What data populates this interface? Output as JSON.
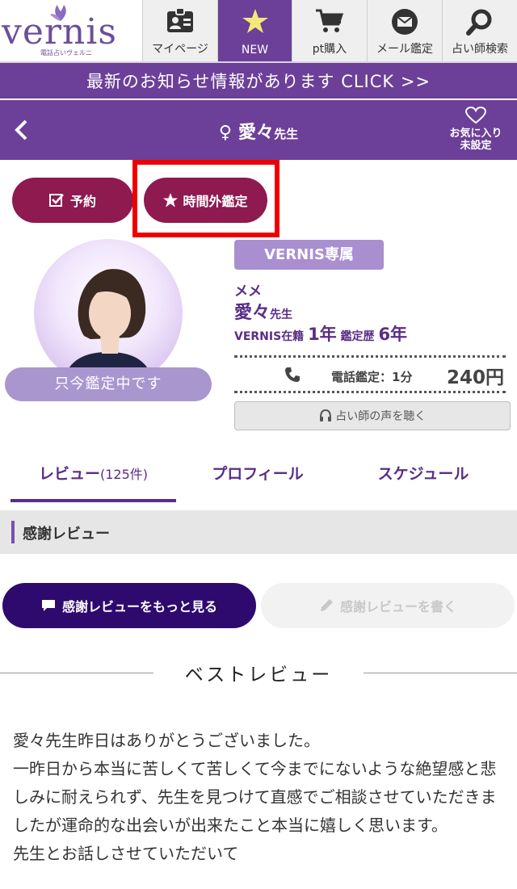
{
  "brand": {
    "logo_text": "vernis",
    "logo_sub": "電話占いヴェルニ"
  },
  "nav": [
    {
      "label": "マイページ",
      "icon": "id-card-icon"
    },
    {
      "label": "NEW",
      "icon": "star-icon"
    },
    {
      "label": "pt購入",
      "icon": "cart-icon"
    },
    {
      "label": "メール鑑定",
      "icon": "mail-icon"
    },
    {
      "label": "占い師検索",
      "icon": "search-icon"
    }
  ],
  "banner": "最新のお知らせ情報があります CLICK >>",
  "header": {
    "venus": "♀",
    "name": "愛々",
    "suffix": "先生",
    "fav_line1": "お気に入り",
    "fav_line2": "未設定"
  },
  "actions": {
    "reserve": "予約",
    "off_hours": "時間外鑑定"
  },
  "profile": {
    "status": "只今鑑定中です",
    "badge": "VERNIS専属",
    "nickname": "メメ",
    "name": "愛々",
    "suffix": "先生",
    "enrolled_label": "VERNIS在籍",
    "enrolled_value": "1年",
    "experience_label": "鑑定歴",
    "experience_value": "6年",
    "price_label": "電話鑑定：1分",
    "price_value": "240円",
    "voice_button": "占い師の声を聴く"
  },
  "tabs": [
    {
      "label": "レビュー",
      "count": "(125件)"
    },
    {
      "label": "プロフィール",
      "count": ""
    },
    {
      "label": "スケジュール",
      "count": ""
    }
  ],
  "section_title": "感謝レビュー",
  "review_buttons": {
    "more": "感謝レビューをもっと見る",
    "write": "感謝レビューを書く"
  },
  "best_review": {
    "title": "ベストレビュー",
    "lines": [
      "愛々先生昨日はありがとうございました。",
      "一昨日から本当に苦しくて苦しくて今までにないような絶望感と悲しみに耐えられず、先生を見つけて直感でご相談させていただきましたが運命的な出会いが出来たこと本当に嬉しく思います。",
      "先生とお話しさせていただいて"
    ]
  },
  "colors": {
    "brand_purple": "#6c3f98",
    "button_maroon": "#8e1a50",
    "dark_navy": "#2e0a6e",
    "highlight_red": "#ee0000"
  }
}
